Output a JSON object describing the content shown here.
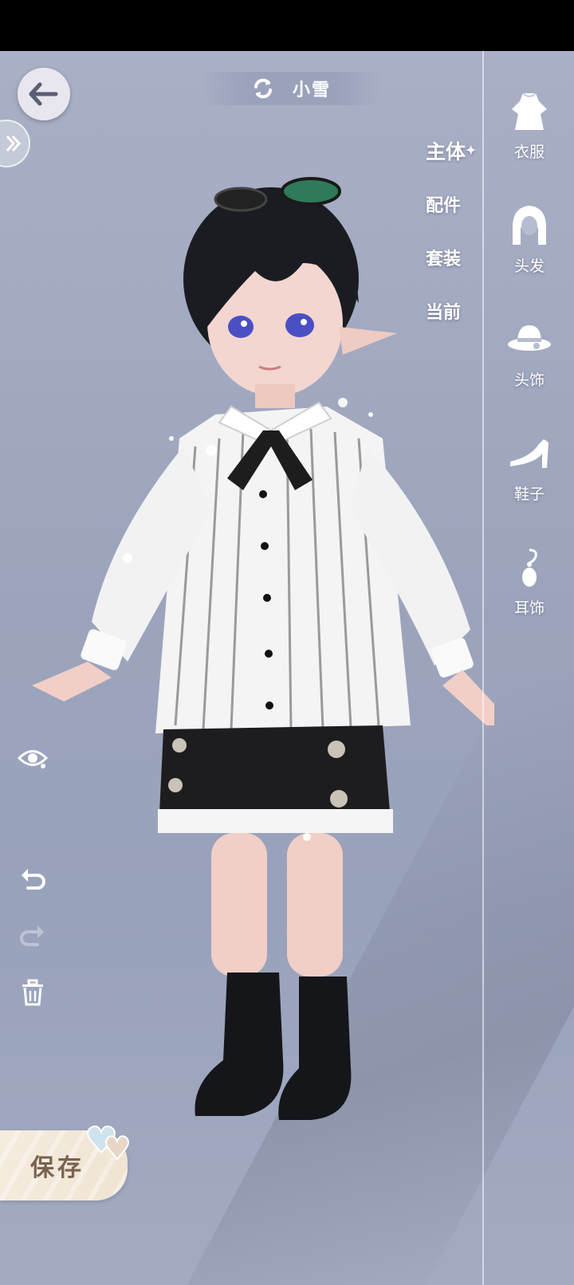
{
  "header": {
    "character_name": "小雪",
    "switch_icon": "refresh-icon"
  },
  "navigation": {
    "back_icon": "back-arrow-icon",
    "collapse_icon": "double-chevron-right-icon"
  },
  "subtabs": [
    {
      "label": "主体",
      "active": true
    },
    {
      "label": "配件",
      "active": false
    },
    {
      "label": "套装",
      "active": false
    },
    {
      "label": "当前",
      "active": false
    }
  ],
  "categories": [
    {
      "label": "衣服",
      "icon": "dress-icon"
    },
    {
      "label": "头发",
      "icon": "hair-icon"
    },
    {
      "label": "头饰",
      "icon": "hat-icon"
    },
    {
      "label": "鞋子",
      "icon": "shoe-icon"
    },
    {
      "label": "耳饰",
      "icon": "earring-icon"
    }
  ],
  "tools": {
    "visibility_icon": "eye-icon",
    "undo_icon": "undo-icon",
    "redo_icon": "redo-icon",
    "delete_icon": "trash-icon"
  },
  "footer": {
    "save_label": "保存"
  },
  "colors": {
    "background": "#9da5bd",
    "topbar": "#000000",
    "save_text": "#7b6250",
    "save_bg": "#f2e8d8"
  }
}
